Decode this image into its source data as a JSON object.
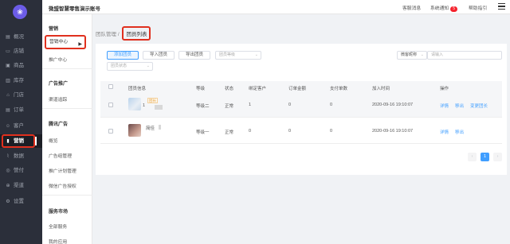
{
  "topbar": {
    "title": "微盟智慧零售演示账号",
    "links": [
      "客服消息",
      "系统通知",
      "帮助指引"
    ],
    "notify_count": "5"
  },
  "nav": {
    "items": [
      {
        "icon": "▤",
        "label": "概况"
      },
      {
        "icon": "▭",
        "label": "店铺"
      },
      {
        "icon": "▣",
        "label": "商品"
      },
      {
        "icon": "▥",
        "label": "库存"
      },
      {
        "icon": "⌂",
        "label": "门店"
      },
      {
        "icon": "▤",
        "label": "订单"
      },
      {
        "icon": "☺",
        "label": "客户"
      },
      {
        "icon": "▮",
        "label": "营销"
      },
      {
        "icon": "⌇",
        "label": "数据"
      },
      {
        "icon": "◎",
        "label": "營付"
      },
      {
        "icon": "⊕",
        "label": "渠道"
      },
      {
        "icon": "⚙",
        "label": "设置"
      }
    ]
  },
  "subnav": {
    "section1": "营销",
    "item_marketing_center": "营销中心",
    "item_promo_center": "推广中心",
    "section2": "广告推广",
    "item_channel": "渠道追踪",
    "section3": "腾讯广告",
    "item_overview": "概览",
    "item_account": "广告组管理",
    "item_plan": "推广计划管理",
    "item_auth": "微信广告授权",
    "section4": "服务市场",
    "item_all": "全部服务",
    "item_mine": "我的应用"
  },
  "breadcrumb": {
    "parent": "团队管理",
    "sep": "/",
    "current": "团员列表"
  },
  "toolbar": {
    "add": "添加团员",
    "import": "导入团员",
    "export": "导出团员",
    "level_placeholder": "团员等级",
    "status_placeholder": "团员状态",
    "search_type": "微客昵称",
    "search_placeholder": "请输入"
  },
  "table": {
    "headers": [
      "团员信息",
      "等级",
      "状态",
      "绑定客户",
      "订单金额",
      "支付单数",
      "加入时间",
      "操作"
    ],
    "rows": [
      {
        "tag": "团长",
        "id": "1",
        "name": "",
        "level": "等级二",
        "status": "正常",
        "customers": "1",
        "amount": "0",
        "orders": "0",
        "time": "2020-09-16 19:10:07",
        "actions": [
          "详情",
          "移出",
          "变更团长"
        ]
      },
      {
        "tag": "",
        "id": "",
        "name": "简佳",
        "level": "等级一",
        "status": "正常",
        "customers": "0",
        "amount": "0",
        "orders": "0",
        "time": "2020-09-16 19:10:07",
        "actions": [
          "详情",
          "移出"
        ]
      }
    ]
  },
  "pager": {
    "prev": "‹",
    "page": "1",
    "next": "›"
  },
  "colors": {
    "accent": "#409eff",
    "highlight": "#e0301e",
    "nav_bg": "#2b2f3a"
  }
}
